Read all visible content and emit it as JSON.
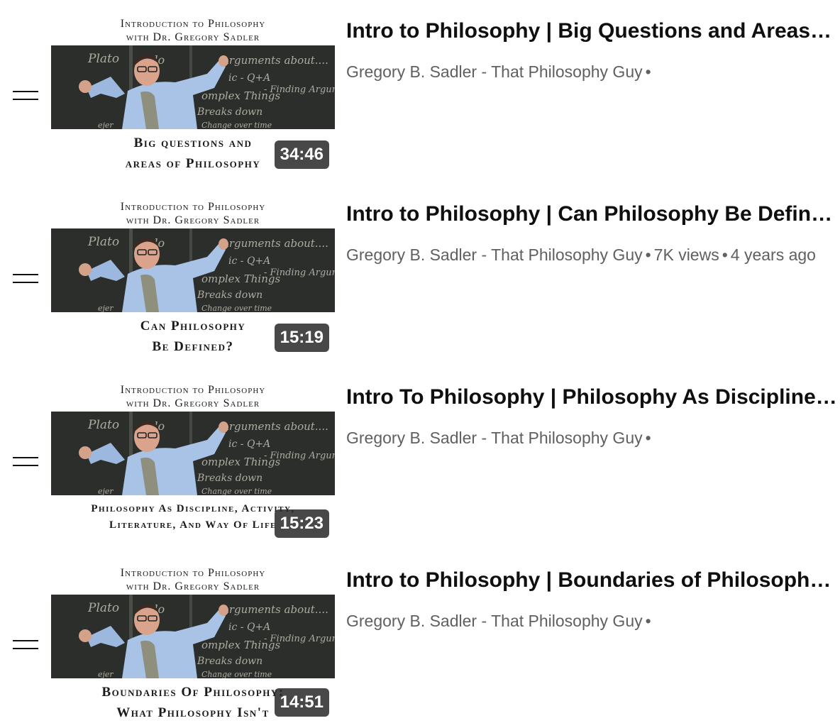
{
  "thumbnail_common": {
    "header_line1": "Introduction to Philosophy",
    "header_line2": "with Dr. Gregory Sadler",
    "board_words": [
      "Plato",
      "ndo",
      "Arguments about....",
      "ic - Q+A",
      "- Finding Arguments",
      "omplex Things",
      "Breaks down",
      "Change over time",
      "ejer"
    ]
  },
  "videos": [
    {
      "title": "Intro to Philosophy | Big Questions and Areas of Philosophy",
      "channel": "Gregory B. Sadler - That Philosophy Guy",
      "separator": "•",
      "views": "",
      "age": "",
      "duration": "34:46",
      "caption_line1": "Big questions and",
      "caption_line2": "areas of Philosophy"
    },
    {
      "title": "Intro to Philosophy | Can Philosophy Be Defined?",
      "channel": "Gregory B. Sadler - That Philosophy Guy",
      "separator": "•",
      "views": "7K views",
      "age": "4 years ago",
      "duration": "15:19",
      "caption_line1": "Can Philosophy",
      "caption_line2": "Be Defined?"
    },
    {
      "title": "Intro To Philosophy | Philosophy As Discipline, Activity, Literature, And Way Of Life",
      "channel": "Gregory B. Sadler - That Philosophy Guy",
      "separator": "•",
      "views": "",
      "age": "",
      "duration": "15:23",
      "caption_line1": "Philosophy As Discipline, Activity,",
      "caption_line2": "Literature, And Way Of Life"
    },
    {
      "title": "Intro to Philosophy | Boundaries of Philosophy - What Philosophy Isn't",
      "channel": "Gregory B. Sadler - That Philosophy Guy",
      "separator": "•",
      "views": "",
      "age": "",
      "duration": "14:51",
      "caption_line1": "Boundaries Of Philosophy:",
      "caption_line2": "What Philosophy Isn't"
    }
  ]
}
